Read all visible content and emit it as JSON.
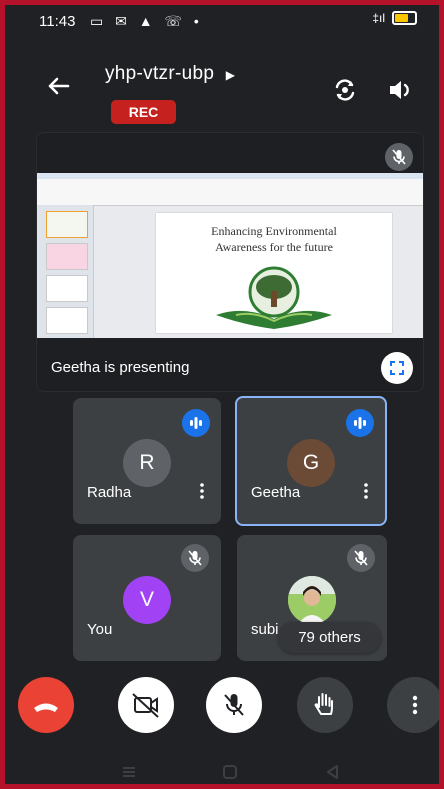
{
  "status_bar": {
    "time": "11:43",
    "left_icons": [
      "video-call-icon",
      "gmail-icon",
      "notification-bell-icon",
      "whatsapp-icon",
      "dot-icon"
    ],
    "left_icons_display": "▭ ✉ ▲ ☏ •",
    "signal": "‡ıl",
    "battery_fill": 0.75,
    "battery_color": "#f9c600"
  },
  "meeting": {
    "code": "yhp-vtzr-ubp",
    "recording_badge": "REC",
    "switch_camera_icon": "switch-camera-icon",
    "speaker_icon": "speaker-icon"
  },
  "presentation": {
    "status": "Geetha is presenting",
    "slide_title_line1": "Enhancing Environmental",
    "slide_title_line2": "Awareness for the future",
    "thumbnail_count": 4,
    "thumbnail_colors": [
      "#f4f7ef",
      "#f9d4e2",
      "#ffffff",
      "#ffffff"
    ]
  },
  "participants": [
    {
      "id": "radha",
      "initial": "R",
      "name": "Radha",
      "speaking": true,
      "muted": false,
      "avatar_color": "#5f6368"
    },
    {
      "id": "geetha",
      "initial": "G",
      "name": "Geetha",
      "speaking": true,
      "muted": false,
      "active": true,
      "avatar_color": "#6b4a36"
    },
    {
      "id": "you",
      "initial": "V",
      "name": "You",
      "speaking": false,
      "muted": true,
      "avatar_color": "#a142f4"
    },
    {
      "id": "subi",
      "initial": "",
      "name": "subi",
      "speaking": false,
      "muted": true,
      "avatar_color": "#cfd8dc"
    }
  ],
  "others_count_label": "79 others",
  "controls": {
    "end_call_color": "#ea4335",
    "buttons": [
      "end-call",
      "camera-off",
      "mic-off",
      "raise-hand",
      "more-options"
    ]
  },
  "accent_colors": {
    "speaking": "#1a73e8",
    "active_border": "#8ab4f8",
    "rec": "#c5221f",
    "frame": "#b3122a"
  }
}
